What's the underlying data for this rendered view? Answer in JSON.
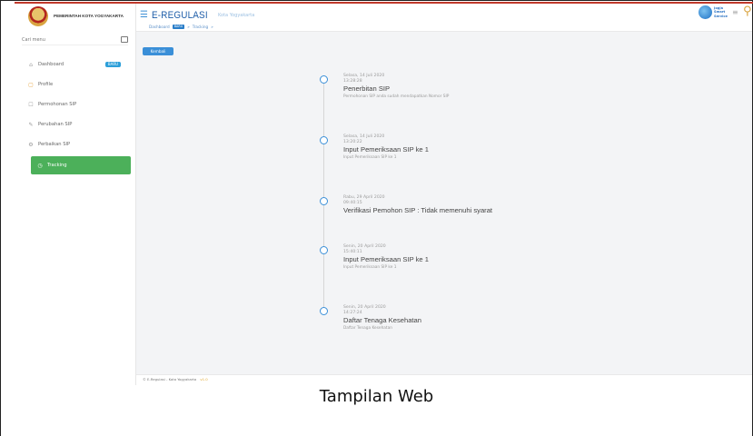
{
  "brand": {
    "name": "PEMERINTAH KOTA YOGYAKARTA"
  },
  "search": {
    "placeholder": "Cari menu"
  },
  "sidebar": {
    "items": [
      {
        "label": "Dashboard",
        "icon": "home-icon",
        "badge": "BARU"
      },
      {
        "label": "Profile",
        "icon": "user-icon"
      },
      {
        "label": "Permohonan SIP",
        "icon": "document-icon"
      },
      {
        "label": "Perubahan SIP",
        "icon": "edit-icon"
      },
      {
        "label": "Perbaikan SIP",
        "icon": "wrench-icon"
      },
      {
        "label": "Tracking",
        "icon": "clock-icon",
        "active": true
      }
    ]
  },
  "header": {
    "title": "E-REGULASI",
    "subtitle": "Kota Yogyakarta",
    "logo_text_1": "Jogja",
    "logo_text_2": "Smart",
    "logo_text_3": "Service"
  },
  "breadcrumb": {
    "item1": "Dashboard",
    "badge": "BARU",
    "item2": "Tracking"
  },
  "back_button": {
    "label": "Kembali"
  },
  "timeline": [
    {
      "date": "Selasa, 14 Juli 2020",
      "time": "13:28:28",
      "title": "Penerbitan SIP",
      "desc": "Permohonan SIP anda sudah mendapatkan Nomor SIP"
    },
    {
      "date": "Selasa, 14 Juli 2020",
      "time": "13:20:22",
      "title": "Input Pemeriksaan SIP ke 1",
      "desc": "Input Pemeriksaan SIP ke 1"
    },
    {
      "date": "Rabu, 29 April 2020",
      "time": "09:40:15",
      "title": "Verifikasi Pemohon SIP : Tidak memenuhi syarat",
      "desc": ""
    },
    {
      "date": "Senin, 20 April 2020",
      "time": "15:40:11",
      "title": "Input Pemeriksaan SIP ke 1",
      "desc": "Input Pemeriksaan SIP ke 1"
    },
    {
      "date": "Senin, 20 April 2020",
      "time": "14:27:24",
      "title": "Daftar Tenaga Kesehatan",
      "desc": "Daftar Tenaga Kesehatan"
    }
  ],
  "footer": {
    "text": "© E-Regulasi - Kota Yogyakarta",
    "version": "v1.0"
  },
  "caption": "Tampilan Web",
  "colors": {
    "accent": "#3a8fd8",
    "active": "#4cb05a",
    "title": "#1e5da8"
  }
}
